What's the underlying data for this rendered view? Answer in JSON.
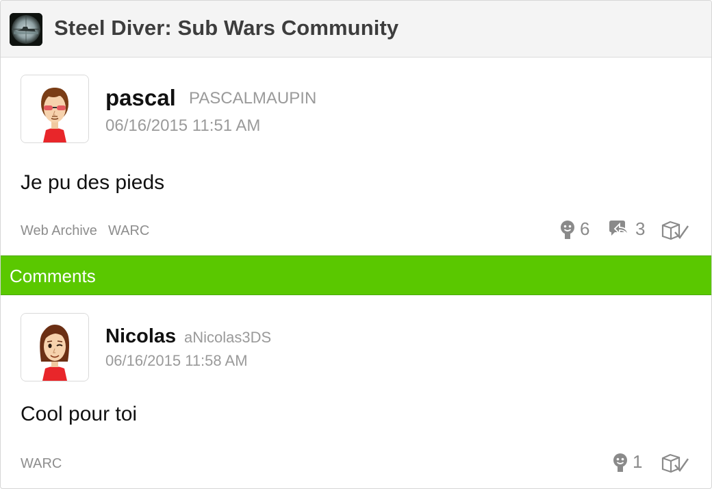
{
  "community": {
    "title": "Steel Diver: Sub Wars Community",
    "icon": "submarine-periscope-icon"
  },
  "post": {
    "screen_name": "pascal",
    "user_id": "PASCALMAUPIN",
    "timestamp": "06/16/2015 11:51 AM",
    "body": "Je pu des pieds",
    "tags": [
      "Web Archive",
      "WARC"
    ],
    "yeah_count": "6",
    "reply_count": "3",
    "avatar_icon": "mii-avatar-pascal"
  },
  "comments_header": {
    "label": "Comments",
    "color": "#5ac800"
  },
  "comment": {
    "screen_name": "Nicolas",
    "user_id": "aNicolas3DS",
    "timestamp": "06/16/2015 11:58 AM",
    "body": "Cool pour toi",
    "tags": [
      "WARC"
    ],
    "yeah_count": "1",
    "avatar_icon": "mii-avatar-nicolas"
  }
}
